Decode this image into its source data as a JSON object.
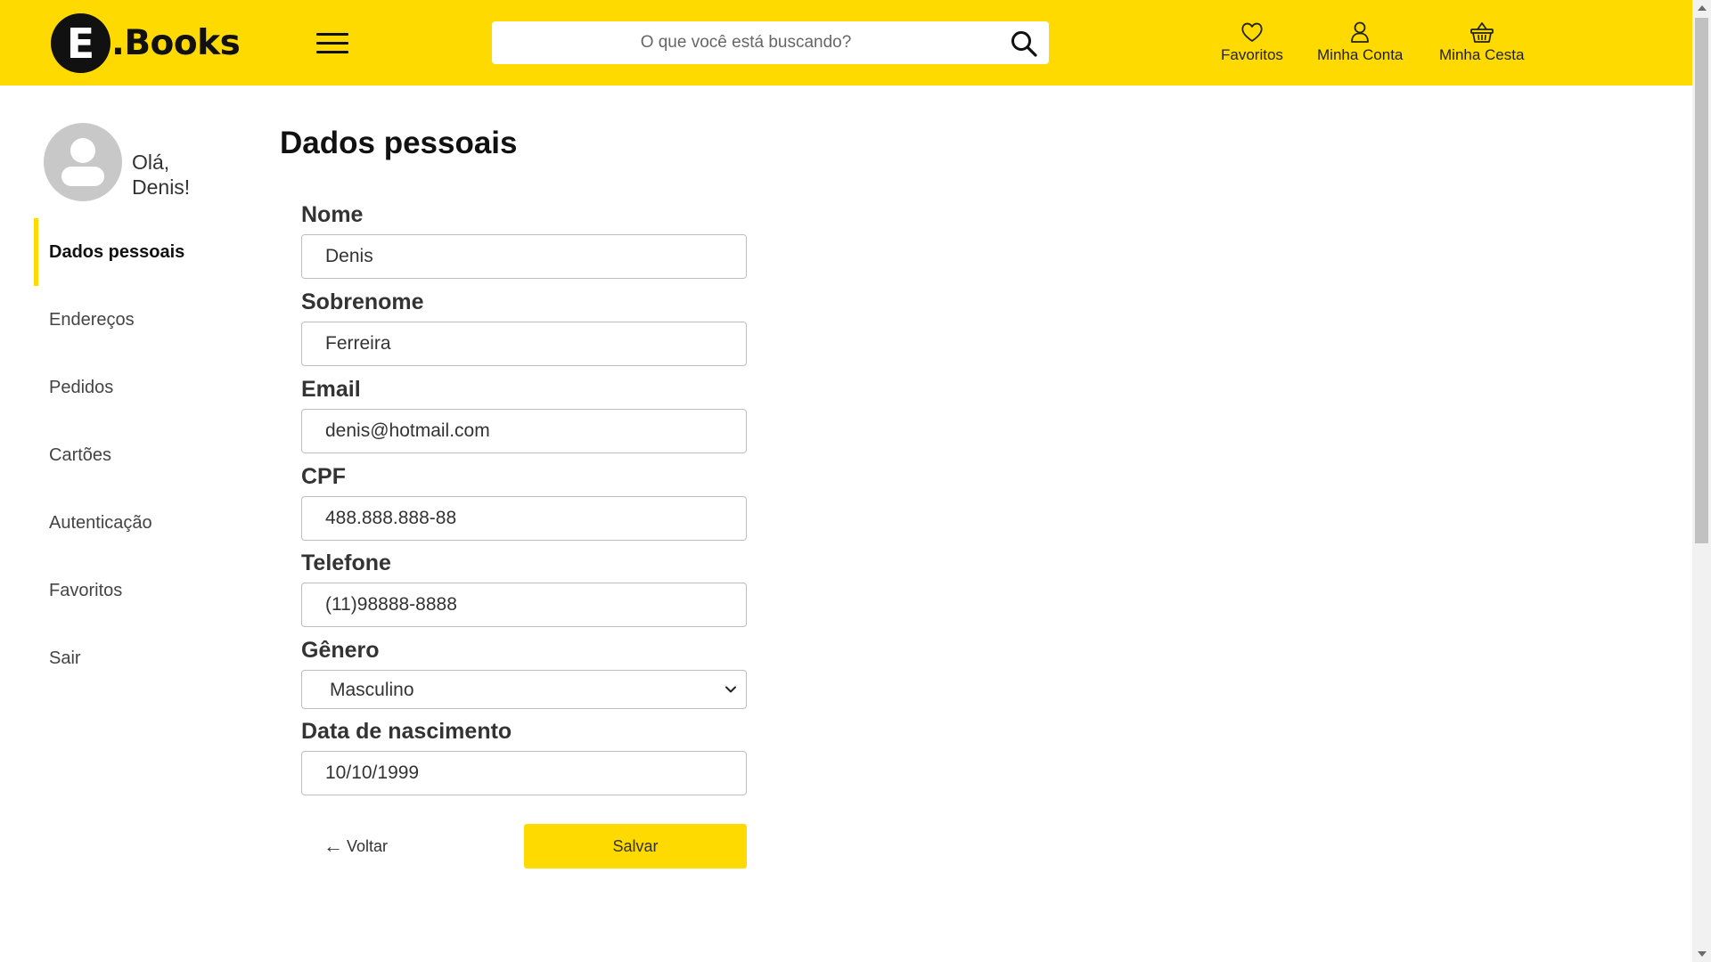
{
  "header": {
    "logo_letter": "E",
    "logo_text": ".Books",
    "search_placeholder": "O que você está buscando?",
    "links": {
      "favorites": "Favoritos",
      "account": "Minha Conta",
      "cart": "Minha Cesta"
    }
  },
  "sidebar": {
    "greeting_line1": "Olá,",
    "greeting_line2": "Denis!",
    "items": [
      {
        "label": "Dados pessoais",
        "active": true
      },
      {
        "label": "Endereços"
      },
      {
        "label": "Pedidos"
      },
      {
        "label": "Cartões"
      },
      {
        "label": "Autenticação"
      },
      {
        "label": "Favoritos"
      },
      {
        "label": "Sair"
      }
    ]
  },
  "form": {
    "title": "Dados pessoais",
    "fields": {
      "nome": {
        "label": "Nome",
        "value": "Denis"
      },
      "sobrenome": {
        "label": "Sobrenome",
        "value": "Ferreira"
      },
      "email": {
        "label": "Email",
        "value": "denis@hotmail.com"
      },
      "cpf": {
        "label": "CPF",
        "value": "488.888.888-88"
      },
      "telefone": {
        "label": "Telefone",
        "value": "(11)98888-8888"
      },
      "genero": {
        "label": "Gênero",
        "value": "Masculino"
      },
      "nascimento": {
        "label": "Data de nascimento",
        "value": "10/10/1999"
      }
    },
    "back_label": "Voltar",
    "save_label": "Salvar"
  },
  "colors": {
    "accent": "#FFDA00",
    "text_dark": "#111111"
  }
}
